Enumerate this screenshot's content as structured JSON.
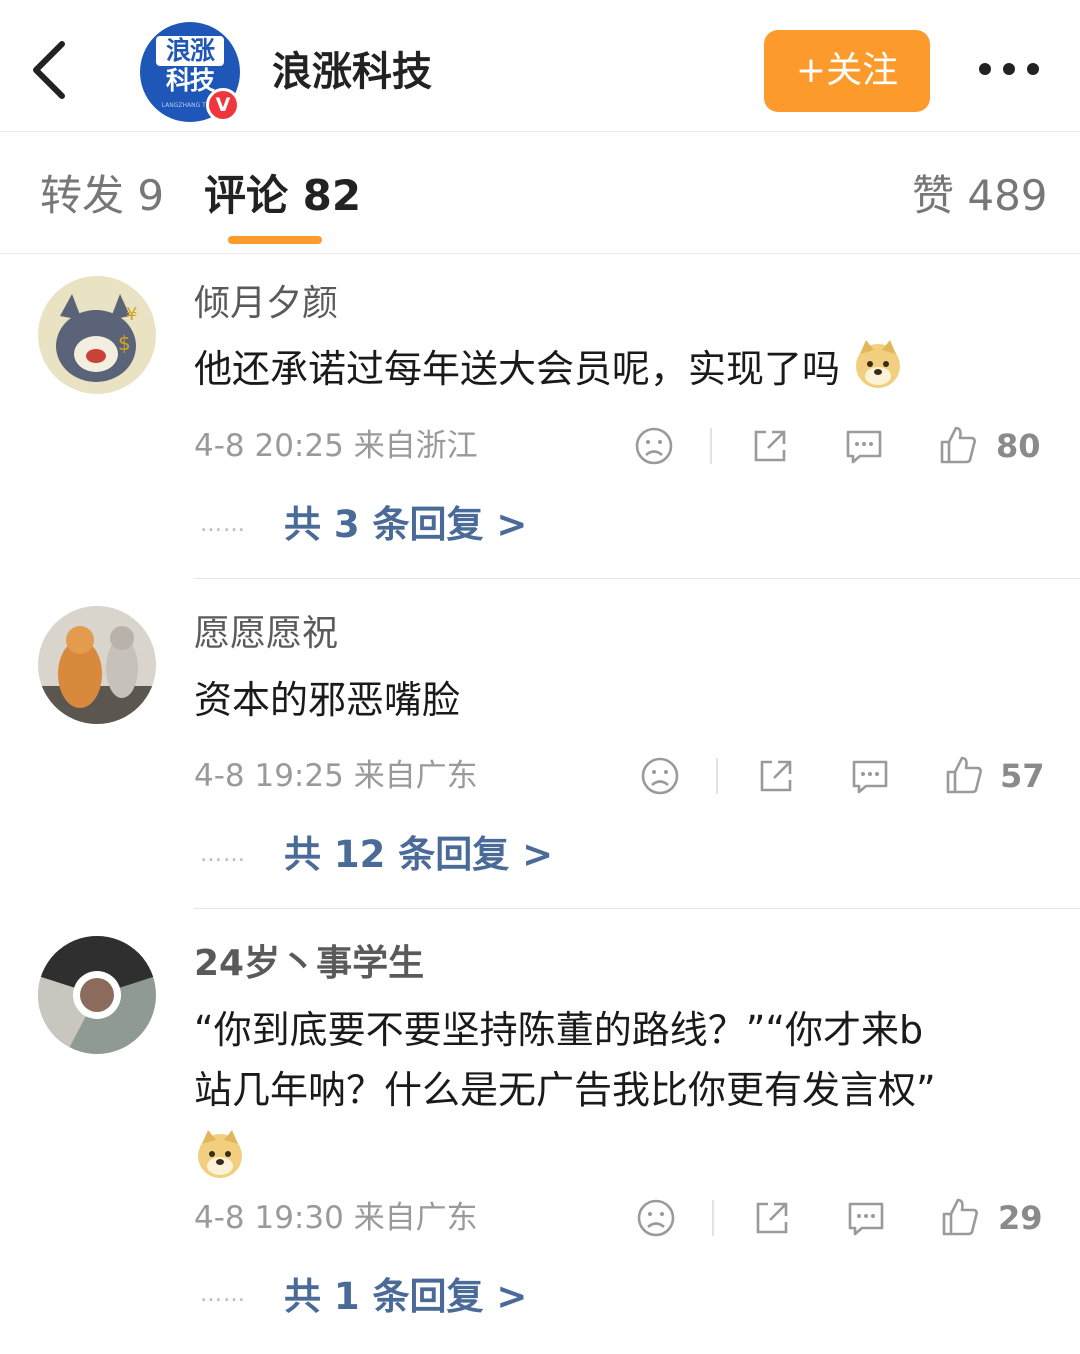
{
  "header": {
    "account_name": "浪涨科技",
    "brand_line1": "浪涨",
    "brand_line2": "科技",
    "brand_sub": "LANGZHANG TECH",
    "verified_badge": "V",
    "follow_label": "+关注"
  },
  "tabs": [
    {
      "label": "转发 9"
    },
    {
      "label": "评论 82"
    },
    {
      "label": "赞 489"
    }
  ],
  "comments": [
    {
      "user": "倾月夕颜",
      "text": "他还承诺过每年送大会员呢，实现了吗",
      "time": "4-8 20:25",
      "location": "来自浙江",
      "likes": "80",
      "replies_label": "共 3 条回复 >",
      "dots": "……"
    },
    {
      "user": "愿愿愿祝",
      "text": "资本的邪恶嘴脸",
      "time": "4-8 19:25",
      "location": "来自广东",
      "likes": "57",
      "replies_label": "共 12 条回复 >",
      "dots": "……"
    },
    {
      "user": "24岁丶事学生",
      "text_line1": "“你到底要不要坚持陈董的路线？”“你才来b",
      "text_line2": "站几年呐？什么是无广告我比你更有发言权”",
      "time": "4-8 19:30",
      "location": "来自广东",
      "likes": "29",
      "replies_label": "共 1 条回复 >",
      "dots": "……"
    }
  ],
  "colors": {
    "accent": "#fc9a2b",
    "link": "#4a6a98",
    "brand": "#1f57b8"
  },
  "icons": [
    "back-arrow-icon",
    "more-icon",
    "dislike-icon",
    "share-icon",
    "comment-icon",
    "like-icon",
    "doge-emoji"
  ]
}
